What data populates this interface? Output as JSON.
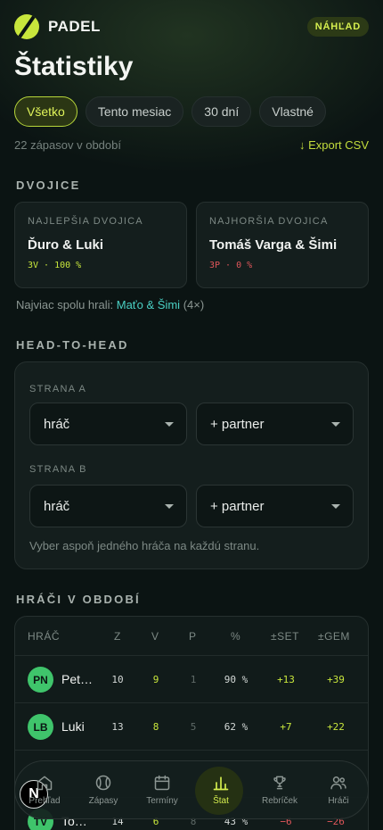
{
  "header": {
    "brand": "PADEL",
    "badge": "NÁHĽAD"
  },
  "page_title": "Štatistiky",
  "filters": [
    {
      "label": "Všetko",
      "active": true
    },
    {
      "label": "Tento mesiac",
      "active": false
    },
    {
      "label": "30 dní",
      "active": false
    },
    {
      "label": "Vlastné",
      "active": false
    }
  ],
  "period": {
    "count_text": "22 zápasov v období",
    "export_label": "↓ Export CSV"
  },
  "pairs": {
    "section_title": "DVOJICE",
    "best": {
      "caption": "NAJLEPŠIA DVOJICA",
      "names": "Ďuro & Luki",
      "stat": "3V · 100 %"
    },
    "worst": {
      "caption": "NAJHORŠIA DVOJICA",
      "names": "Tomáš Varga & Šimi",
      "stat": "3P · 0 %"
    },
    "most_played_prefix": "Najviac spolu hrali:",
    "most_played_pair": "Maťo & Šimi",
    "most_played_count": "(4×)"
  },
  "h2h": {
    "section_title": "HEAD-TO-HEAD",
    "side_a_label": "STRANA A",
    "side_b_label": "STRANA B",
    "player_placeholder": "hráč",
    "partner_placeholder": "+ partner",
    "hint": "Vyber aspoň jedného hráča na každú stranu."
  },
  "players": {
    "section_title": "HRÁČI V OBDOBÍ",
    "columns": [
      "HRÁČ",
      "Z",
      "V",
      "P",
      "%",
      "±SET",
      "±GEM"
    ],
    "rows": [
      {
        "initials": "PN",
        "name": "Pet…",
        "z": "10",
        "v": "9",
        "p": "1",
        "pct": "90 %",
        "set": "+13",
        "gem": "+39"
      },
      {
        "initials": "LB",
        "name": "Luki",
        "z": "13",
        "v": "8",
        "p": "5",
        "pct": "62 %",
        "set": "+7",
        "gem": "+22"
      },
      {
        "initials": "",
        "name": "",
        "z": "",
        "v": "",
        "p": "",
        "pct": "",
        "set": "",
        "gem": ""
      },
      {
        "initials": "TV",
        "name": "To…",
        "z": "14",
        "v": "6",
        "p": "8",
        "pct": "43 %",
        "set": "−6",
        "gem": "−26"
      }
    ]
  },
  "nav": {
    "fab_letter": "N",
    "items": [
      {
        "label": "Prehľad",
        "icon": "home-icon",
        "active": false
      },
      {
        "label": "Zápasy",
        "icon": "ball-icon",
        "active": false
      },
      {
        "label": "Termíny",
        "icon": "calendar-icon",
        "active": false
      },
      {
        "label": "Štat",
        "icon": "bar-chart-icon",
        "active": true
      },
      {
        "label": "Rebríček",
        "icon": "trophy-icon",
        "active": false
      },
      {
        "label": "Hráči",
        "icon": "users-icon",
        "active": false
      }
    ]
  },
  "colors": {
    "accent": "#c8e63c",
    "negative": "#e0565a",
    "teal": "#4ad0c4",
    "background": "#0b1413"
  }
}
